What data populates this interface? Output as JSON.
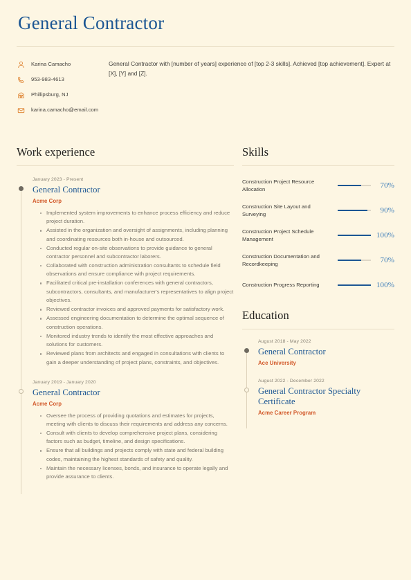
{
  "header": {
    "title": "General Contractor",
    "contacts": [
      {
        "icon": "person-icon",
        "text": "Karina Camacho"
      },
      {
        "icon": "phone-icon",
        "text": "953-983-4613"
      },
      {
        "icon": "building-icon",
        "text": "Phillipsburg, NJ"
      },
      {
        "icon": "email-icon",
        "text": "karina.camacho@email.com"
      }
    ],
    "summary": "General Contractor with [number of years] experience of [top 2-3 skills]. Achieved [top achievement]. Expert at [X], [Y] and [Z]."
  },
  "work": {
    "section_title": "Work experience",
    "entries": [
      {
        "date": "January 2023 - Present",
        "role": "General Contractor",
        "org": "Acme Corp",
        "marker": "filled",
        "bullets": [
          "Implemented system improvements to enhance process efficiency and reduce project duration.",
          "Assisted in the organization and oversight of assignments, including planning and coordinating resources both in-house and outsourced.",
          "Conducted regular on-site observations to provide guidance to general contractor personnel and subcontractor laborers.",
          "Collaborated with construction administration consultants to schedule field observations and ensure compliance with project requirements.",
          "Facilitated critical pre-installation conferences with general contractors, subcontractors, consultants, and manufacturer's representatives to align project objectives.",
          "Reviewed contractor invoices and approved payments for satisfactory work.",
          "Assessed engineering documentation to determine the optimal sequence of construction operations.",
          "Monitored industry trends to identify the most effective approaches and solutions for customers.",
          "Reviewed plans from architects and engaged in consultations with clients to gain a deeper understanding of project plans, constraints, and objectives."
        ]
      },
      {
        "date": "January 2019 - January 2020",
        "role": "General Contractor",
        "org": "Acme Corp",
        "marker": "hollow",
        "bullets": [
          "Oversee the process of providing quotations and estimates for projects, meeting with clients to discuss their requirements and address any concerns.",
          "Consult with clients to develop comprehensive project plans, considering factors such as budget, timeline, and design specifications.",
          "Ensure that all buildings and projects comply with state and federal building codes, maintaining the highest standards of safety and quality.",
          "Maintain the necessary licenses, bonds, and insurance to operate legally and provide assurance to clients."
        ]
      }
    ]
  },
  "skills": {
    "section_title": "Skills",
    "items": [
      {
        "name": "Construction Project Resource Allocation",
        "percent": "70%",
        "value": 70
      },
      {
        "name": "Construction Site Layout and Surveying",
        "percent": "90%",
        "value": 90
      },
      {
        "name": "Construction Project Schedule Management",
        "percent": "100%",
        "value": 100
      },
      {
        "name": "Construction Documentation and Recordkeeping",
        "percent": "70%",
        "value": 70
      },
      {
        "name": "Construction Progress Reporting",
        "percent": "100%",
        "value": 100
      }
    ]
  },
  "education": {
    "section_title": "Education",
    "entries": [
      {
        "date": "August 2018 - May 2022",
        "degree": "General Contractor",
        "org": "Ace University",
        "marker": "filled"
      },
      {
        "date": "August 2022 - December 2022",
        "degree": "General Contractor Specialty Certificate",
        "org": "Acme Career Program",
        "marker": "hollow"
      }
    ]
  },
  "colors": {
    "background": "#fdf6e3",
    "accent_blue": "#1c5693",
    "accent_orange": "#d2592a",
    "icon_orange": "#e08a3c",
    "rule": "#e8ddc4",
    "body_text": "#7a756b"
  }
}
